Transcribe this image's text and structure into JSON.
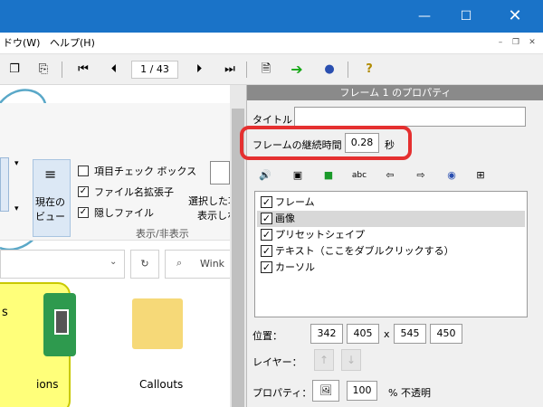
{
  "menu": [
    {
      "label": "ドウ(W)"
    },
    {
      "label": "ヘルプ(H)"
    }
  ],
  "toolbar": {
    "page_indicator": "1 / 43"
  },
  "ribbon": {
    "checkbox_item_check": "項目チェック ボックス",
    "checkbox_extensions": "ファイル名拡張子",
    "checkbox_hidden": "隠しファイル",
    "current_view_line1": "現在の",
    "current_view_line2": "ビュー",
    "selected_line1": "選択した項",
    "selected_line2": "表示しな",
    "group_label": "表示/非表示"
  },
  "explorer": {
    "search_placeholder": "Wink",
    "folder_label_left": "ions",
    "folder_label_right": "Callouts",
    "yellow_text": "s"
  },
  "properties": {
    "header": "フレーム 1 のプロパティ",
    "title_label": "タイトル",
    "title_value": "",
    "duration_label": "フレームの継続時間",
    "duration_value": "0.28",
    "duration_unit": "秒",
    "layers": [
      {
        "label": "フレーム",
        "checked": true
      },
      {
        "label": "画像",
        "checked": true
      },
      {
        "label": "プリセットシェイプ",
        "checked": true
      },
      {
        "label": "テキスト（ここをダブルクリックする）",
        "checked": true
      },
      {
        "label": "カーソル",
        "checked": true
      }
    ],
    "position_label": "位置：",
    "pos_x": "342",
    "pos_y": "405",
    "pos_sep": "x",
    "size_w": "545",
    "size_h": "450",
    "layer_label": "レイヤー：",
    "property_label": "プロパティ：",
    "opacity_value": "100",
    "opacity_unit": "% 不透明"
  },
  "colors": {
    "titlebar": "#1a73c8",
    "highlight": "#e53030"
  }
}
